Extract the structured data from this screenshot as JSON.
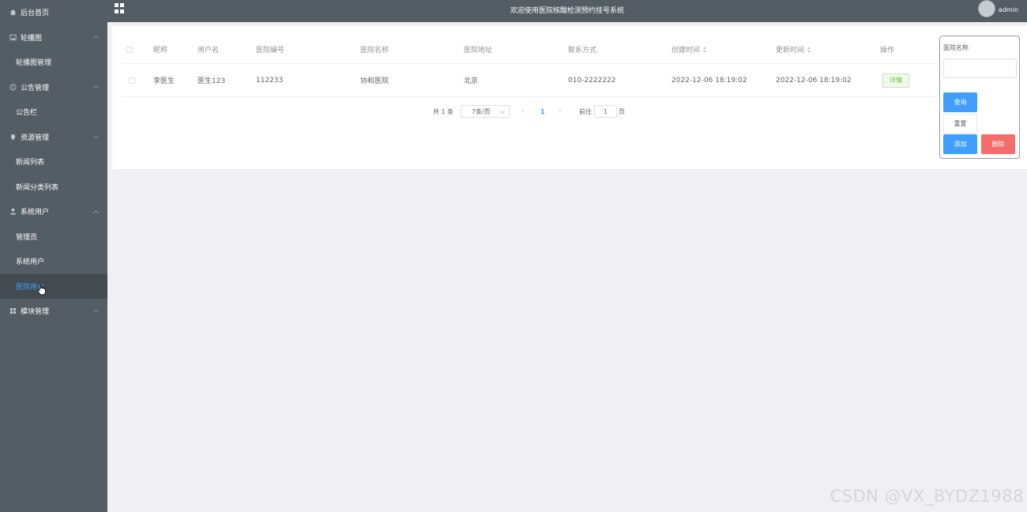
{
  "header": {
    "title": "欢迎使用医院核酸检测预约挂号系统",
    "user": "admin"
  },
  "sidebar": {
    "items": [
      {
        "type": "parent",
        "label": "后台首页",
        "icon": "home-icon",
        "chevron": "none"
      },
      {
        "type": "parent",
        "label": "轮播图",
        "icon": "picture-icon",
        "chevron": "up"
      },
      {
        "type": "child",
        "label": "轮播图管理"
      },
      {
        "type": "parent",
        "label": "公告管理",
        "icon": "info-icon",
        "chevron": "up"
      },
      {
        "type": "child",
        "label": "公告栏"
      },
      {
        "type": "parent",
        "label": "资源管理",
        "icon": "location-icon",
        "chevron": "up"
      },
      {
        "type": "child",
        "label": "新闻列表"
      },
      {
        "type": "child",
        "label": "新闻分类列表"
      },
      {
        "type": "parent",
        "label": "系统用户",
        "icon": "user-icon",
        "chevron": "up"
      },
      {
        "type": "child",
        "label": "管理员"
      },
      {
        "type": "child",
        "label": "系统用户"
      },
      {
        "type": "child",
        "label": "医院用户",
        "active": true
      },
      {
        "type": "parent",
        "label": "模块管理",
        "icon": "grid-icon",
        "chevron": "down"
      }
    ]
  },
  "table": {
    "columns": [
      "昵称",
      "用户名",
      "医院编号",
      "医院名称",
      "医院地址",
      "联系方式",
      "创建时间",
      "更新时间",
      "操作"
    ],
    "rows": [
      {
        "nickname": "李医生",
        "username": "医生123",
        "hospital_no": "112233",
        "hospital_name": "协和医院",
        "hospital_address": "北京",
        "contact": "010-2222222",
        "created": "2022-12-06 18:19:02",
        "updated": "2022-12-06 18:19:02",
        "action_label": "详情"
      }
    ]
  },
  "pagination": {
    "total_text": "共 1 条",
    "page_size": "7条/页",
    "current_page": "1",
    "goto_label": "前往",
    "goto_value": "1",
    "page_unit": "页"
  },
  "search": {
    "label": "医院名称",
    "value": "",
    "query_label": "查询",
    "reset_label": "重置",
    "add_label": "添加",
    "delete_label": "删除"
  },
  "watermark": "CSDN @VX_BYDZ1988",
  "colors": {
    "sidebar_bg": "#545c64",
    "active_text": "#409eff",
    "primary": "#409eff",
    "danger": "#f56c6c",
    "success": "#67c23a"
  }
}
